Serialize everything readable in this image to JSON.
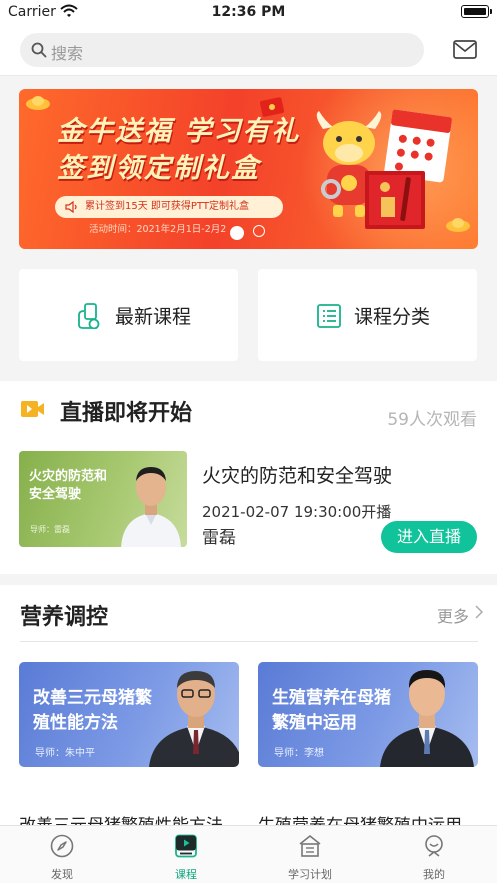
{
  "status_bar": {
    "carrier": "Carrier",
    "time": "12:36 PM"
  },
  "search": {
    "placeholder": "搜索"
  },
  "banner": {
    "title_line1": "金牛送福 学习有礼",
    "title_line2": "签到领定制礼盒",
    "pill_text": "累计签到15天  即可获得PTT定制礼盒",
    "date_text": "活动时间：2021年2月1日-2月2",
    "page_count": 2,
    "active_page": 1
  },
  "entries": [
    {
      "label": "最新课程",
      "icon": "new-course-icon"
    },
    {
      "label": "课程分类",
      "icon": "category-list-icon"
    }
  ],
  "live": {
    "section_title": "直播即将开始",
    "views": "59人次观看",
    "thumb_title": "火灾的防范和安全驾驶",
    "thumb_teacher": "导师：雷磊",
    "course_title": "火灾的防范和安全驾驶",
    "time": "2021-02-07 19:30:00开播",
    "teacher": "雷磊",
    "enter_label": "进入直播"
  },
  "nutrition": {
    "section_title": "营养调控",
    "more_label": "更多",
    "courses": [
      {
        "card_title": "改善三元母猪繁殖性能方法",
        "card_teacher": "导师：朱中平",
        "name": "改善三元母猪繁殖性能方法"
      },
      {
        "card_title": "生殖营养在母猪繁殖中运用",
        "card_teacher": "导师：李想",
        "name": "生殖营养在母猪繁殖中运用"
      }
    ]
  },
  "tabbar": {
    "tabs": [
      {
        "label": "发现",
        "icon": "compass-icon",
        "active": false
      },
      {
        "label": "课程",
        "icon": "course-play-icon",
        "active": true
      },
      {
        "label": "学习计划",
        "icon": "study-plan-icon",
        "active": false
      },
      {
        "label": "我的",
        "icon": "profile-icon",
        "active": false
      }
    ]
  },
  "colors": {
    "accent": "#11c39a",
    "tab_active": "#11a77f",
    "banner_red": "#f3412a",
    "card_blue": "#5a7bd6",
    "thumb_green": "#86b04c",
    "video_icon": "#f5b324"
  }
}
